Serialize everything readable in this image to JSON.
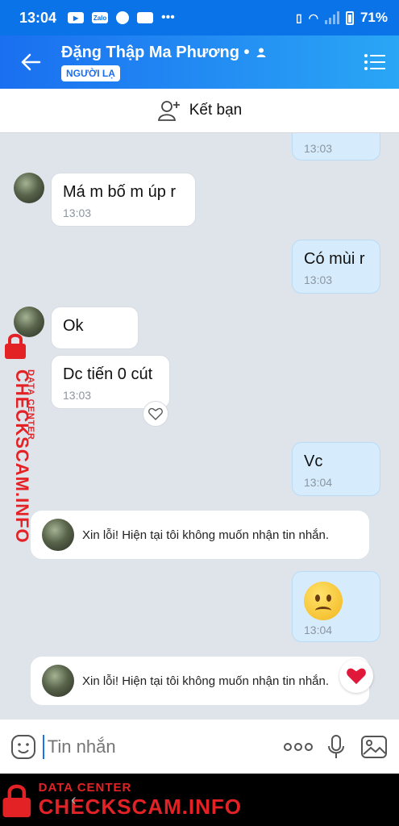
{
  "status_bar": {
    "time": "13:04",
    "app_icons": [
      "youtube-icon",
      "zalo-icon",
      "chrome-icon",
      "gallery-icon",
      "more-icon"
    ],
    "zalo_label": "Zalo",
    "battery": "71%"
  },
  "header": {
    "contact_name": "Đặng Thập Ma Phương •",
    "badge": "NGƯỜI LẠ"
  },
  "add_friend": {
    "label": "Kết bạn"
  },
  "messages": [
    {
      "side": "me",
      "text": "...",
      "time": "13:03"
    },
    {
      "side": "them",
      "text": "Má m bố m úp r",
      "time": "13:03"
    },
    {
      "side": "me",
      "text": "Có mùi r",
      "time": "13:03"
    },
    {
      "side": "them",
      "text": "Ok",
      "time": ""
    },
    {
      "side": "them",
      "text": "Dc tiến 0 cút",
      "time": "13:03"
    },
    {
      "side": "me",
      "text": "Vc",
      "time": "13:04"
    },
    {
      "side": "system",
      "text": "Xin lỗi! Hiện tại tôi không muốn nhận tin nhắn."
    },
    {
      "side": "me",
      "emoji": "frowning-face",
      "time": "13:04"
    },
    {
      "side": "system",
      "text": "Xin lỗi! Hiện tại tôi không muốn nhận tin nhắn."
    }
  ],
  "input": {
    "placeholder": "Tin nhắn"
  },
  "watermark": {
    "small": "DATA CENTER",
    "big": "CHECKSCAM.INFO"
  },
  "colors": {
    "accent": "#1a6ff0",
    "my_bubble": "#d6ecfc",
    "watermark": "#e32226"
  }
}
